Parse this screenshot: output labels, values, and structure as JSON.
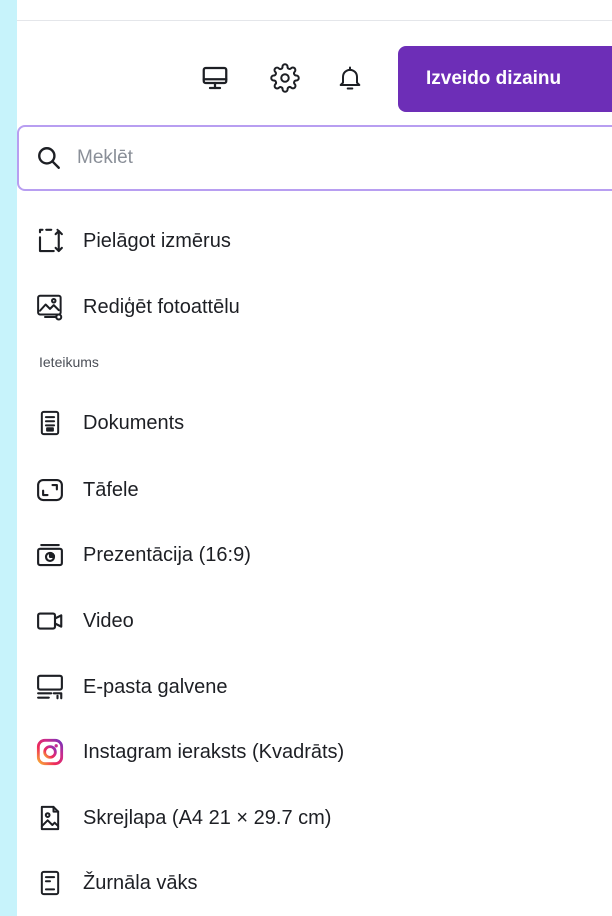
{
  "toolbar": {
    "monitor_icon": "desktop-icon",
    "settings_icon": "gear-icon",
    "notifications_icon": "bell-icon",
    "create_label": "Izveido dizainu"
  },
  "search": {
    "placeholder": "Meklēt"
  },
  "quick_actions": [
    {
      "label": "Pielāgot izmērus",
      "icon": "resize-icon"
    },
    {
      "label": "Rediģēt fotoattēlu",
      "icon": "edit-photo-icon"
    }
  ],
  "section": {
    "label": "Ieteikums"
  },
  "suggestions": [
    {
      "label": "Dokuments",
      "icon": "document-icon"
    },
    {
      "label": "Tāfele",
      "icon": "whiteboard-icon"
    },
    {
      "label": "Prezentācija (16:9)",
      "icon": "presentation-icon"
    },
    {
      "label": "Video",
      "icon": "video-icon"
    },
    {
      "label": "E-pasta galvene",
      "icon": "email-header-icon"
    },
    {
      "label": "Instagram ieraksts (Kvadrāts)",
      "icon": "instagram-icon"
    },
    {
      "label": "Skrejlapa (A4 21 × 29.7 cm)",
      "icon": "flyer-icon"
    },
    {
      "label": "Žurnāla vāks",
      "icon": "magazine-icon"
    }
  ],
  "colors": {
    "accent": "#6d2eb7",
    "search_border": "#b89ef1",
    "background": "#c7f3fb"
  }
}
